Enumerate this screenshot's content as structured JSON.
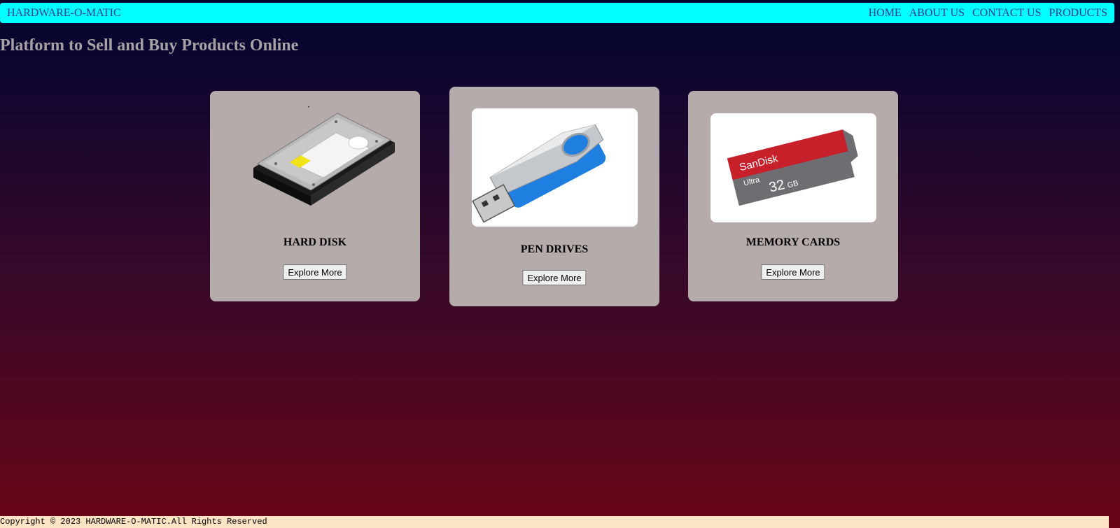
{
  "navbar": {
    "brand": "HARDWARE-O-MATIC",
    "links": [
      "HOME",
      "ABOUT US",
      "CONTACT US",
      "PRODUCTS"
    ]
  },
  "headline": "Platform to Sell and Buy Products Online",
  "products": [
    {
      "title": "HARD DISK",
      "button": "Explore More",
      "image": "hard-disk-image"
    },
    {
      "title": "PEN DRIVES",
      "button": "Explore More",
      "image": "pen-drive-image"
    },
    {
      "title": "MEMORY CARDS",
      "button": "Explore More",
      "image": "memory-card-image",
      "card_text": "SanDisk",
      "card_sub": "Ultra",
      "card_size": "32",
      "card_unit": "GB"
    }
  ],
  "footer": "Copyright © 2023 HARDWARE-O-MATIC.All Rights Reserved",
  "colors": {
    "navbar": "#00ffff",
    "nav_text": "#2f3a8a",
    "card": "#b6abab",
    "footer": "#fde4c4"
  }
}
